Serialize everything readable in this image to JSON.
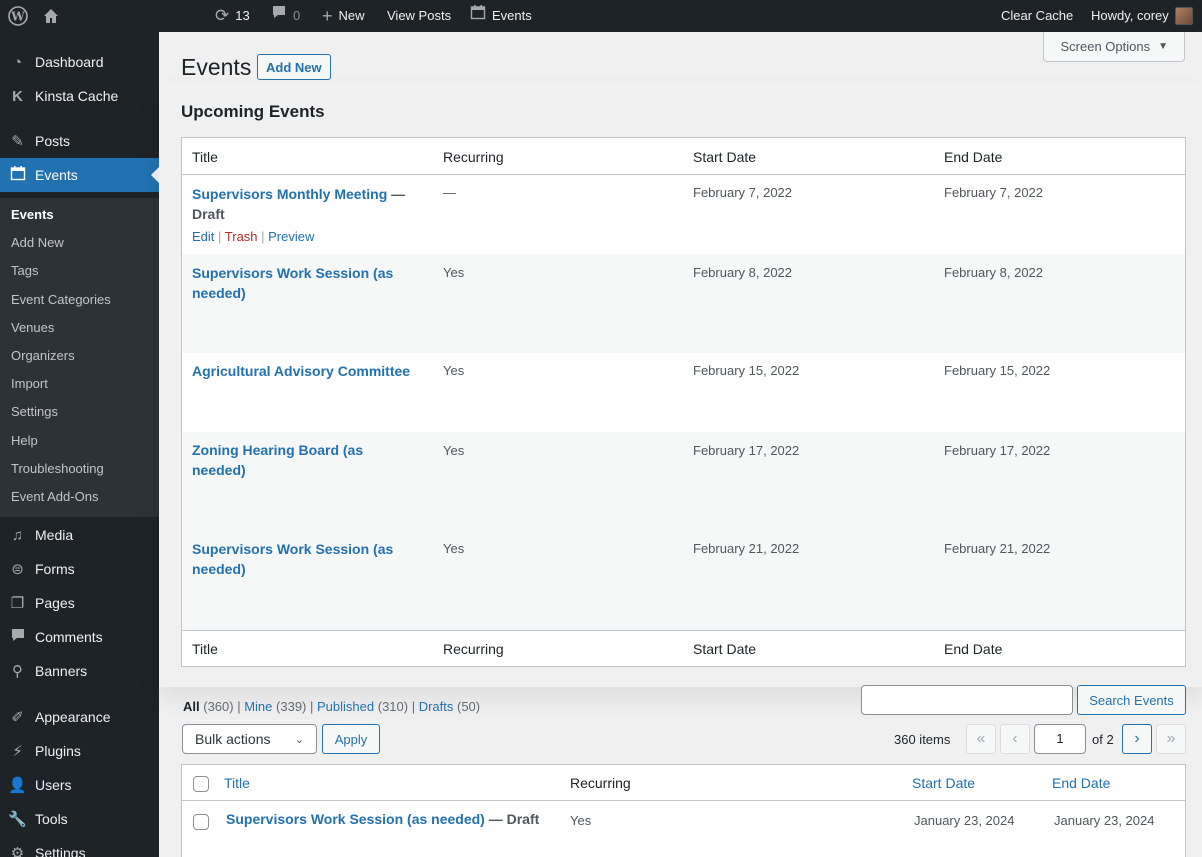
{
  "adminbar": {
    "wp_logo_icon": "wordpress-logo",
    "home_icon": "home-icon",
    "updates_count": "13",
    "comments_count": "0",
    "new_label": "New",
    "view_posts_label": "View Posts",
    "events_label": "Events",
    "clear_cache_label": "Clear Cache",
    "howdy_label": "Howdy, corey"
  },
  "sidebar": {
    "items": [
      {
        "label": "Dashboard",
        "icon": "dashboard-icon"
      },
      {
        "label": "Kinsta Cache",
        "icon": "kinsta-icon"
      },
      {
        "label": "Posts",
        "icon": "pin-icon"
      },
      {
        "label": "Events",
        "icon": "calendar-icon"
      },
      {
        "label": "Media",
        "icon": "media-icon"
      },
      {
        "label": "Forms",
        "icon": "forms-icon"
      },
      {
        "label": "Pages",
        "icon": "pages-icon"
      },
      {
        "label": "Comments",
        "icon": "comments-icon"
      },
      {
        "label": "Banners",
        "icon": "pin-icon"
      },
      {
        "label": "Appearance",
        "icon": "brush-icon"
      },
      {
        "label": "Plugins",
        "icon": "plug-icon"
      },
      {
        "label": "Users",
        "icon": "user-icon"
      },
      {
        "label": "Tools",
        "icon": "wrench-icon"
      },
      {
        "label": "Settings",
        "icon": "settings-icon"
      }
    ],
    "submenu": [
      "Events",
      "Add New",
      "Tags",
      "Event Categories",
      "Venues",
      "Organizers",
      "Import",
      "Settings",
      "Help",
      "Troubleshooting",
      "Event Add-Ons"
    ]
  },
  "header": {
    "screen_options": "Screen Options",
    "title": "Events",
    "add_new": "Add New"
  },
  "upcoming": {
    "title": "Upcoming Events",
    "columns": [
      "Title",
      "Recurring",
      "Start Date",
      "End Date"
    ],
    "rows": [
      {
        "title": "Supervisors Monthly Meeting",
        "status": "— Draft",
        "recurring": "—",
        "start": "February 7, 2022",
        "end": "February 7, 2022"
      },
      {
        "title": "Supervisors Work Session (as needed)",
        "status": "",
        "recurring": "Yes",
        "start": "February 8, 2022",
        "end": "February 8, 2022"
      },
      {
        "title": "Agricultural Advisory Committee",
        "status": "",
        "recurring": "Yes",
        "start": "February 15, 2022",
        "end": "February 15, 2022"
      },
      {
        "title": "Zoning Hearing Board (as needed)",
        "status": "",
        "recurring": "Yes",
        "start": "February 17, 2022",
        "end": "February 17, 2022"
      },
      {
        "title": "Supervisors Work Session (as needed)",
        "status": "",
        "recurring": "Yes",
        "start": "February 21, 2022",
        "end": "February 21, 2022"
      }
    ],
    "row_actions": {
      "edit": "Edit",
      "trash": "Trash",
      "preview": "Preview"
    }
  },
  "filters": {
    "all": "All",
    "all_count": "(360)",
    "mine": "Mine",
    "mine_count": "(339)",
    "published": "Published",
    "published_count": "(310)",
    "drafts": "Drafts",
    "drafts_count": "(50)"
  },
  "search": {
    "button": "Search Events",
    "value": ""
  },
  "tablenav": {
    "bulk_actions": "Bulk actions",
    "apply": "Apply",
    "items": "360 items",
    "first": "«",
    "prev": "‹",
    "next": "›",
    "last": "»",
    "current_page": "1",
    "of_pages": "of 2"
  },
  "list": {
    "columns": [
      "Title",
      "Recurring",
      "Start Date",
      "End Date"
    ],
    "rows": [
      {
        "title": "Supervisors Work Session (as needed)",
        "status": "— Draft",
        "recurring": "Yes",
        "start": "January 23, 2024",
        "end": "January 23, 2024"
      }
    ]
  },
  "colors": {
    "accent": "#2271b1",
    "sidebar": "#1d2327",
    "trash": "#b32d2e"
  }
}
